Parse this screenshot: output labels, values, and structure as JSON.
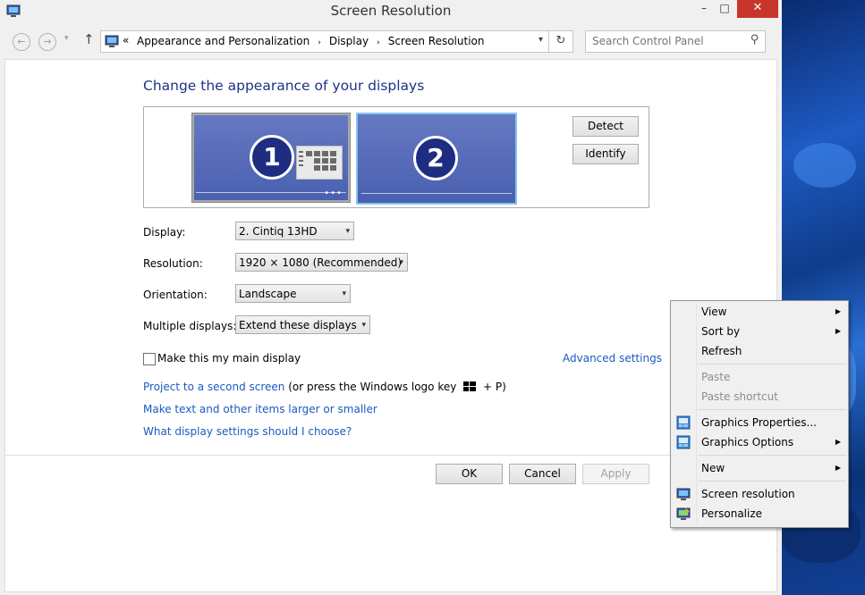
{
  "window": {
    "title": "Screen Resolution",
    "min_glyph": "–",
    "max_glyph": "□",
    "close_glyph": "✕"
  },
  "nav": {
    "back_glyph": "←",
    "forward_glyph": "→",
    "recent_glyph": "▾",
    "up_glyph": "↑",
    "overflow": "«",
    "breadcrumb": [
      "Appearance and Personalization",
      "Display",
      "Screen Resolution"
    ],
    "crumb_sep": "›",
    "dropdown_glyph": "▾",
    "refresh_glyph": "↻",
    "search_placeholder": "Search Control Panel",
    "search_glyph": "⚲"
  },
  "main": {
    "heading": "Change the appearance of your displays",
    "monitors": [
      "1",
      "2"
    ],
    "detect_label": "Detect",
    "identify_label": "Identify",
    "settings": [
      {
        "label": "Display:",
        "value": "2. Cintiq 13HD"
      },
      {
        "label": "Resolution:",
        "value": "1920 × 1080 (Recommended)"
      },
      {
        "label": "Orientation:",
        "value": "Landscape"
      },
      {
        "label": "Multiple displays:",
        "value": "Extend these displays"
      }
    ],
    "main_display_label": "Make this my main display",
    "advanced_link": "Advanced settings",
    "project_link": "Project to a second screen",
    "project_suffix_a": "(or press the Windows logo key",
    "project_suffix_b": "+ P)",
    "text_size_link": "Make text and other items larger or smaller",
    "help_link": "What display settings should I choose?",
    "ok_label": "OK",
    "cancel_label": "Cancel",
    "apply_label": "Apply"
  },
  "context_menu": {
    "items": [
      {
        "label": "View",
        "submenu": true,
        "disabled": false
      },
      {
        "label": "Sort by",
        "submenu": true,
        "disabled": false
      },
      {
        "label": "Refresh",
        "submenu": false,
        "disabled": false
      },
      {
        "label": "Paste",
        "submenu": false,
        "disabled": true
      },
      {
        "label": "Paste shortcut",
        "submenu": false,
        "disabled": true
      },
      {
        "label": "Graphics Properties...",
        "submenu": false,
        "disabled": false,
        "icon": "graphics-icon"
      },
      {
        "label": "Graphics Options",
        "submenu": true,
        "disabled": false,
        "icon": "graphics-icon"
      },
      {
        "label": "New",
        "submenu": true,
        "disabled": false
      },
      {
        "label": "Screen resolution",
        "submenu": false,
        "disabled": false,
        "icon": "display-icon"
      },
      {
        "label": "Personalize",
        "submenu": false,
        "disabled": false,
        "icon": "personalize-icon"
      }
    ],
    "arrow_glyph": "▶"
  },
  "colors": {
    "heading": "#1e3287",
    "link": "#1a5bbf",
    "monitor_fill": "#5066b5",
    "selected_border": "#87c2ef",
    "close_button": "#c7352b"
  }
}
